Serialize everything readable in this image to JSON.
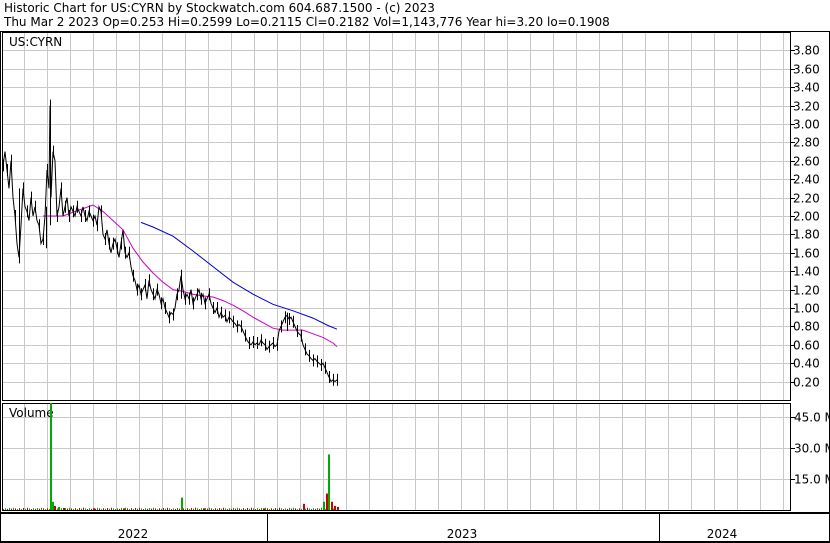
{
  "header": {
    "line1": "Historic Chart for US:CYRN by Stockwatch.com 604.687.1500 - (c) 2023",
    "line2": "Thu Mar  2 2023   Op=0.253   Hi=0.2599   Lo=0.2115   Cl=0.2182   Vol=1,143,776   Year hi=3.20   lo=0.1908"
  },
  "chart_data": [
    {
      "type": "line",
      "label": "US:CYRN",
      "ylim": [
        0.0,
        4.0
      ],
      "y_ticks": [
        "0.20",
        "0.40",
        "0.60",
        "0.80",
        "1.00",
        "1.20",
        "1.40",
        "1.60",
        "1.80",
        "2.00",
        "2.20",
        "2.40",
        "2.60",
        "2.80",
        "3.00",
        "3.20",
        "3.40",
        "3.60",
        "3.80"
      ],
      "grid": true,
      "colors": {
        "price": "#000000",
        "ma_short": "#cc00cc",
        "ma_long": "#0000cc",
        "grid": "#c8c8c8"
      },
      "price_points": [
        [
          0,
          2.55
        ],
        [
          2,
          2.7
        ],
        [
          4,
          2.5
        ],
        [
          6,
          2.3
        ],
        [
          8,
          2.6
        ],
        [
          10,
          2.2
        ],
        [
          12,
          2.0
        ],
        [
          14,
          1.7
        ],
        [
          16,
          1.55
        ],
        [
          18,
          1.9
        ],
        [
          20,
          2.3
        ],
        [
          22,
          2.1
        ],
        [
          24,
          2.05
        ],
        [
          26,
          1.95
        ],
        [
          28,
          2.2
        ],
        [
          30,
          2.0
        ],
        [
          32,
          2.1
        ],
        [
          34,
          1.95
        ],
        [
          36,
          1.9
        ],
        [
          38,
          1.7
        ],
        [
          40,
          1.75
        ],
        [
          42,
          2.0
        ],
        [
          44,
          2.5
        ],
        [
          46,
          2.3
        ],
        [
          47,
          3.2
        ],
        [
          48,
          2.2
        ],
        [
          50,
          2.7
        ],
        [
          52,
          2.6
        ],
        [
          54,
          2.0
        ],
        [
          56,
          2.1
        ],
        [
          58,
          2.3
        ],
        [
          60,
          2.0
        ],
        [
          62,
          2.1
        ],
        [
          64,
          2.2
        ],
        [
          66,
          2.0
        ],
        [
          68,
          2.1
        ],
        [
          70,
          2.05
        ],
        [
          72,
          2.0
        ],
        [
          74,
          2.1
        ],
        [
          76,
          2.05
        ],
        [
          78,
          2.0
        ],
        [
          80,
          2.1
        ],
        [
          82,
          2.0
        ],
        [
          84,
          1.95
        ],
        [
          86,
          2.05
        ],
        [
          88,
          2.0
        ],
        [
          90,
          1.95
        ],
        [
          92,
          2.0
        ],
        [
          94,
          1.9
        ],
        [
          96,
          2.1
        ],
        [
          98,
          2.05
        ],
        [
          100,
          1.8
        ],
        [
          102,
          1.75
        ],
        [
          104,
          1.85
        ],
        [
          106,
          1.7
        ],
        [
          108,
          1.6
        ],
        [
          110,
          1.7
        ],
        [
          112,
          1.75
        ],
        [
          114,
          1.65
        ],
        [
          116,
          1.55
        ],
        [
          118,
          1.7
        ],
        [
          120,
          1.85
        ],
        [
          122,
          1.6
        ],
        [
          124,
          1.55
        ],
        [
          126,
          1.6
        ],
        [
          128,
          1.45
        ],
        [
          130,
          1.35
        ],
        [
          132,
          1.3
        ],
        [
          134,
          1.2
        ],
        [
          136,
          1.25
        ],
        [
          138,
          1.15
        ],
        [
          140,
          1.2
        ],
        [
          142,
          1.25
        ],
        [
          144,
          1.1
        ],
        [
          146,
          1.3
        ],
        [
          148,
          1.2
        ],
        [
          150,
          1.15
        ],
        [
          152,
          1.1
        ],
        [
          154,
          1.2
        ],
        [
          156,
          1.15
        ],
        [
          158,
          1.05
        ],
        [
          160,
          1.1
        ],
        [
          162,
          1.0
        ],
        [
          164,
          0.95
        ],
        [
          166,
          0.9
        ],
        [
          168,
          0.95
        ],
        [
          170,
          0.93
        ],
        [
          172,
          1.0
        ],
        [
          174,
          1.15
        ],
        [
          176,
          1.2
        ],
        [
          178,
          1.35
        ],
        [
          180,
          1.2
        ],
        [
          182,
          1.1
        ],
        [
          184,
          1.15
        ],
        [
          186,
          1.1
        ],
        [
          188,
          1.2
        ],
        [
          190,
          1.05
        ],
        [
          192,
          1.1
        ],
        [
          194,
          1.15
        ],
        [
          196,
          1.2
        ],
        [
          198,
          1.1
        ],
        [
          200,
          1.15
        ],
        [
          202,
          1.05
        ],
        [
          204,
          1.1
        ],
        [
          206,
          1.15
        ],
        [
          208,
          1.05
        ],
        [
          210,
          1.0
        ],
        [
          212,
          0.95
        ],
        [
          214,
          1.0
        ],
        [
          216,
          0.9
        ],
        [
          218,
          0.95
        ],
        [
          220,
          0.9
        ],
        [
          222,
          0.92
        ],
        [
          224,
          0.85
        ],
        [
          226,
          0.9
        ],
        [
          228,
          0.88
        ],
        [
          230,
          0.85
        ],
        [
          232,
          0.83
        ],
        [
          234,
          0.8
        ],
        [
          236,
          0.82
        ],
        [
          238,
          0.8
        ],
        [
          240,
          0.75
        ],
        [
          242,
          0.7
        ],
        [
          244,
          0.65
        ],
        [
          246,
          0.62
        ],
        [
          248,
          0.6
        ],
        [
          250,
          0.63
        ],
        [
          252,
          0.6
        ],
        [
          254,
          0.62
        ],
        [
          256,
          0.6
        ],
        [
          258,
          0.65
        ],
        [
          260,
          0.62
        ],
        [
          262,
          0.6
        ],
        [
          264,
          0.55
        ],
        [
          266,
          0.58
        ],
        [
          268,
          0.6
        ],
        [
          270,
          0.62
        ],
        [
          272,
          0.58
        ],
        [
          274,
          0.6
        ],
        [
          276,
          0.75
        ],
        [
          278,
          0.8
        ],
        [
          280,
          0.85
        ],
        [
          282,
          0.9
        ],
        [
          284,
          0.92
        ],
        [
          286,
          0.88
        ],
        [
          288,
          0.9
        ],
        [
          290,
          0.85
        ],
        [
          292,
          0.8
        ],
        [
          294,
          0.75
        ],
        [
          296,
          0.72
        ],
        [
          298,
          0.7
        ],
        [
          300,
          0.6
        ],
        [
          302,
          0.55
        ],
        [
          304,
          0.5
        ],
        [
          306,
          0.48
        ],
        [
          308,
          0.45
        ],
        [
          310,
          0.43
        ],
        [
          312,
          0.45
        ],
        [
          314,
          0.42
        ],
        [
          316,
          0.4
        ],
        [
          318,
          0.38
        ],
        [
          320,
          0.4
        ],
        [
          322,
          0.35
        ],
        [
          324,
          0.3
        ],
        [
          326,
          0.25
        ],
        [
          328,
          0.2
        ],
        [
          330,
          0.22
        ],
        [
          332,
          0.2
        ],
        [
          334,
          0.22
        ]
      ],
      "ma_short_points": [
        [
          40,
          2.0
        ],
        [
          60,
          2.0
        ],
        [
          80,
          2.08
        ],
        [
          90,
          2.12
        ],
        [
          100,
          2.05
        ],
        [
          110,
          1.95
        ],
        [
          120,
          1.85
        ],
        [
          130,
          1.65
        ],
        [
          140,
          1.5
        ],
        [
          150,
          1.38
        ],
        [
          160,
          1.28
        ],
        [
          170,
          1.2
        ],
        [
          180,
          1.18
        ],
        [
          190,
          1.15
        ],
        [
          200,
          1.13
        ],
        [
          210,
          1.12
        ],
        [
          220,
          1.08
        ],
        [
          230,
          1.03
        ],
        [
          240,
          0.97
        ],
        [
          250,
          0.9
        ],
        [
          260,
          0.84
        ],
        [
          270,
          0.78
        ],
        [
          280,
          0.76
        ],
        [
          290,
          0.76
        ],
        [
          300,
          0.76
        ],
        [
          310,
          0.72
        ],
        [
          320,
          0.68
        ],
        [
          330,
          0.62
        ],
        [
          334,
          0.58
        ]
      ],
      "ma_long_points": [
        [
          138,
          1.93
        ],
        [
          150,
          1.88
        ],
        [
          170,
          1.78
        ],
        [
          190,
          1.62
        ],
        [
          210,
          1.45
        ],
        [
          230,
          1.28
        ],
        [
          250,
          1.15
        ],
        [
          270,
          1.04
        ],
        [
          290,
          0.97
        ],
        [
          310,
          0.89
        ],
        [
          325,
          0.81
        ],
        [
          334,
          0.77
        ]
      ],
      "spikes": [
        {
          "x": 47,
          "lo": 1.9,
          "hi": 3.2
        },
        {
          "x": 16,
          "lo": 1.5,
          "hi": 2.3
        },
        {
          "x": 43,
          "lo": 1.65,
          "hi": 2.1
        },
        {
          "x": 178,
          "lo": 1.1,
          "hi": 1.35
        },
        {
          "x": 284,
          "lo": 0.75,
          "hi": 0.95
        },
        {
          "x": 330,
          "lo": 0.19,
          "hi": 0.28
        }
      ]
    },
    {
      "type": "bar",
      "label": "Volume",
      "ylim": [
        0,
        52
      ],
      "y_ticks": [
        "15.0 M",
        "30.0 M",
        "45.0 M"
      ],
      "colors": {
        "up": "#00aa00",
        "down": "#cc0000"
      },
      "bars": [
        {
          "x": 47,
          "v": 52,
          "c": "up"
        },
        {
          "x": 49,
          "v": 4,
          "c": "up"
        },
        {
          "x": 51,
          "v": 2,
          "c": "down"
        },
        {
          "x": 55,
          "v": 1.5,
          "c": "up"
        },
        {
          "x": 60,
          "v": 1,
          "c": "down"
        },
        {
          "x": 90,
          "v": 0.8,
          "c": "down"
        },
        {
          "x": 120,
          "v": 0.8,
          "c": "down"
        },
        {
          "x": 178,
          "v": 6,
          "c": "up"
        },
        {
          "x": 200,
          "v": 0.8,
          "c": "down"
        },
        {
          "x": 260,
          "v": 0.8,
          "c": "down"
        },
        {
          "x": 300,
          "v": 3,
          "c": "down"
        },
        {
          "x": 320,
          "v": 4,
          "c": "up"
        },
        {
          "x": 323,
          "v": 8,
          "c": "down"
        },
        {
          "x": 325,
          "v": 27,
          "c": "up"
        },
        {
          "x": 328,
          "v": 4,
          "c": "down"
        },
        {
          "x": 331,
          "v": 2,
          "c": "down"
        },
        {
          "x": 334,
          "v": 1.5,
          "c": "down"
        }
      ]
    }
  ],
  "x_axis": {
    "labels": [
      "2022",
      "2023",
      "2024"
    ]
  }
}
